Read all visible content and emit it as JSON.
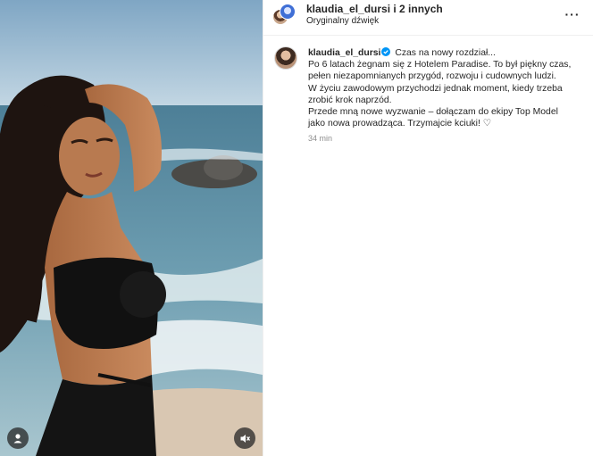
{
  "post": {
    "author": "klaudia_el_dursi",
    "header_user": "klaudia_el_dursi i 2 innych",
    "audio": "Oryginalny dźwięk",
    "more_label": "···"
  },
  "caption": {
    "author": "klaudia_el_dursi",
    "first_line_text": " Czas na nowy rozdział...",
    "lines": [
      "Po 6 latach żegnam się z Hotelem Paradise. To był piękny czas,",
      "pełen niezapomnianych przygód, rozwoju i cudownych ludzi.",
      "W życiu zawodowym przychodzi jednak moment, kiedy trzeba",
      "zrobić krok naprzód.",
      "Przede mną nowe wyzwanie – dołączam do ekipy Top Model",
      "jako nowa prowadząca. Trzymajcie kciuki! ♡"
    ],
    "time": "34 min"
  },
  "icons": {
    "tags": "user-tag-icon",
    "mute": "speaker-muted-icon",
    "verified": "verified-badge-icon",
    "more": "more-options-icon"
  },
  "colors": {
    "verified": "#0095f6",
    "secondary_text": "#8e8e8e",
    "divider": "#efefef"
  }
}
